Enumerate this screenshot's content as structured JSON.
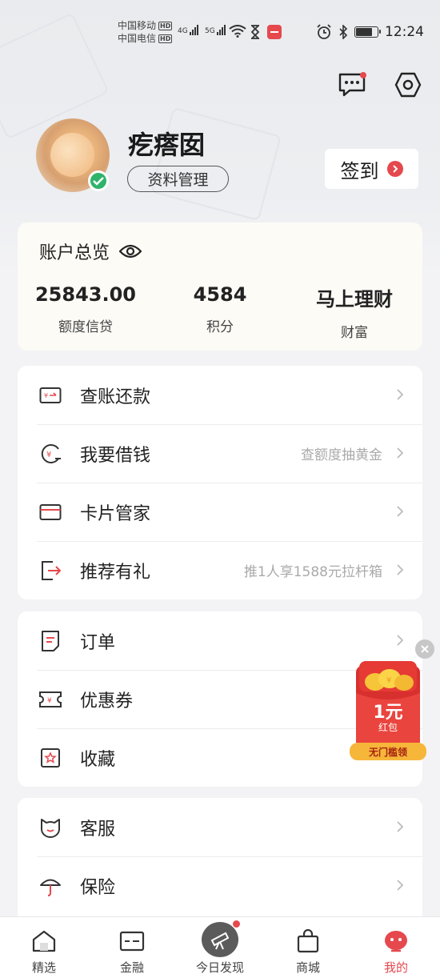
{
  "status_bar": {
    "carrier1": "中国移动",
    "carrier2": "中国电信",
    "hd": "HD",
    "net1": "4G",
    "net2": "5G",
    "time": "12:24"
  },
  "profile": {
    "nickname": "疙瘩囡",
    "manage_label": "资料管理",
    "checkin_label": "签到"
  },
  "account": {
    "title": "账户总览",
    "stats": [
      {
        "value": "25843.00",
        "label": "额度信贷"
      },
      {
        "value": "4584",
        "label": "积分"
      },
      {
        "value": "马上理财",
        "label": "财富"
      }
    ]
  },
  "menu_group1": [
    {
      "label": "查账还款",
      "hint": ""
    },
    {
      "label": "我要借钱",
      "hint": "查额度抽黄金"
    },
    {
      "label": "卡片管家",
      "hint": ""
    },
    {
      "label": "推荐有礼",
      "hint": "推1人享1588元拉杆箱"
    }
  ],
  "menu_group2": [
    {
      "label": "订单"
    },
    {
      "label": "优惠券"
    },
    {
      "label": "收藏"
    }
  ],
  "menu_group3": [
    {
      "label": "客服"
    },
    {
      "label": "保险"
    }
  ],
  "promo": {
    "amount": "1元",
    "sub": "红包",
    "cta": "无门槛领"
  },
  "tabs": [
    {
      "label": "精选",
      "icon": "home-icon"
    },
    {
      "label": "金融",
      "icon": "finance-icon"
    },
    {
      "label": "今日发现",
      "icon": "telescope-icon"
    },
    {
      "label": "商城",
      "icon": "bag-icon"
    },
    {
      "label": "我的",
      "icon": "me-icon"
    }
  ],
  "colors": {
    "accent": "#e5484d",
    "verified": "#2fb36a",
    "background": "#f3f3f5"
  }
}
